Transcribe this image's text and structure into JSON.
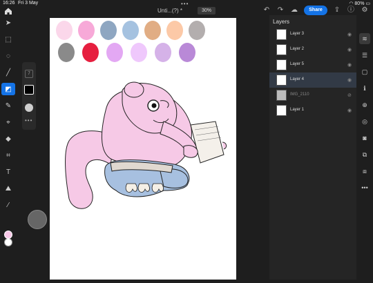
{
  "status": {
    "time": "16:26",
    "date": "Fri 3 May",
    "battery": "80%"
  },
  "document": {
    "title": "Unti...(?) *",
    "zoom": "30%",
    "share_label": "Share"
  },
  "brush": {
    "size": "7"
  },
  "colors": {
    "accent": "#1473e6",
    "foreground": "#f8c8e8",
    "background": "#ffffff",
    "swatches_row1": [
      "#fbd7ea",
      "#f7a9d8",
      "#8ea6c1",
      "#a5c2e0",
      "#e1ad84",
      "#fcc9a7",
      "#b3aeae"
    ],
    "swatches_row2": [
      "#8a8a8a",
      "#e61f3f",
      "#e3a8f3",
      "#efc8fc",
      "#d5b2e8",
      "#b989d7"
    ]
  },
  "layers": {
    "title": "Layers",
    "items": [
      {
        "name": "Layer 3",
        "visible": true,
        "selected": false
      },
      {
        "name": "Layer 2",
        "visible": true,
        "selected": false
      },
      {
        "name": "Layer 5",
        "visible": true,
        "selected": false
      },
      {
        "name": "Layer 4",
        "visible": true,
        "selected": true
      },
      {
        "name": "IMG_2110",
        "visible": false,
        "selected": false
      },
      {
        "name": "Layer 1",
        "visible": true,
        "selected": false
      }
    ]
  }
}
